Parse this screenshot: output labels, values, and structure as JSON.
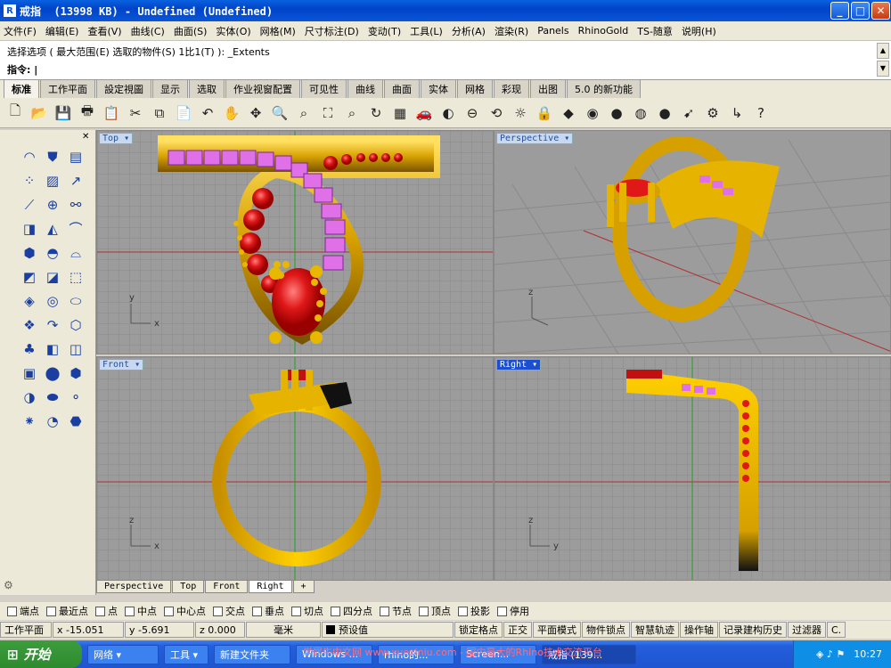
{
  "window": {
    "title": "戒指  (13998 KB) - Undefined (Undefined)",
    "min": "_",
    "max": "□",
    "close": "✕"
  },
  "menu": [
    "文件(F)",
    "编辑(E)",
    "查看(V)",
    "曲线(C)",
    "曲面(S)",
    "实体(O)",
    "网格(M)",
    "尺寸标注(D)",
    "变动(T)",
    "工具(L)",
    "分析(A)",
    "渲染(R)",
    "Panels",
    "RhinoGold",
    "TS-随意",
    "说明(H)"
  ],
  "command": {
    "history": "选择选项 ( 最大范围(E) 选取的物件(S) 1比1(T) ): _Extents",
    "prompt": "指令: |"
  },
  "tabs": [
    "标准",
    "工作平面",
    "設定視圖",
    "显示",
    "选取",
    "作业视窗配置",
    "可见性",
    "曲线",
    "曲面",
    "实体",
    "网格",
    "彩现",
    "出图",
    "5.0 的新功能"
  ],
  "toolbar_icons": [
    "new-icon",
    "open-icon",
    "save-icon",
    "print-icon",
    "import-icon",
    "cut-icon",
    "copy-icon",
    "paste-icon",
    "undo-icon",
    "pan-icon",
    "rotate-view-icon",
    "zoom-icon",
    "zoom-window-icon",
    "zoom-extents-icon",
    "zoom-selected-icon",
    "redo-view-icon",
    "four-viewports-icon",
    "car-icon",
    "hide-icon",
    "show-icon",
    "lock-icon",
    "light-icon",
    "lock2-icon",
    "layer-icon",
    "color-wheel-icon",
    "render-sphere-icon",
    "material-sphere-icon",
    "blue-sphere-icon",
    "options-icon",
    "settings-icon",
    "history-icon",
    "help-icon"
  ],
  "toolbar_glyphs": [
    "🗋",
    "📂",
    "💾",
    "🖶",
    "📋",
    "✂",
    "⧉",
    "📄",
    "↶",
    "✋",
    "✥",
    "🔍",
    "⌕",
    "⛶",
    "⌕",
    "↻",
    "▦",
    "🚗",
    "◐",
    "⊖",
    "⟲",
    "☼",
    "🔒",
    "◆",
    "◉",
    "●",
    "◍",
    "●",
    "➹",
    "⚙",
    "↳",
    "?"
  ],
  "left_tools": [
    "◠",
    "⛊",
    "▤",
    "⁘",
    "▨",
    "↗",
    "⟋",
    "⊕",
    "⚯",
    "◨",
    "◭",
    "⌒",
    "⬢",
    "◓",
    "⌓",
    "◩",
    "◪",
    "⬚",
    "◈",
    "◎",
    "⬭",
    "❖",
    "↷",
    "⬡",
    "♣",
    "◧",
    "◫",
    "▣",
    "⬤",
    "⬢",
    "◑",
    "⬬",
    "⚬",
    "⁕",
    "◔",
    "⬣"
  ],
  "viewports": {
    "top": "Top",
    "perspective": "Perspective",
    "front": "Front",
    "right": "Right"
  },
  "axis": {
    "x": "x",
    "y": "y",
    "z": "z"
  },
  "vp_tabs": [
    "Perspective",
    "Top",
    "Front",
    "Right",
    "+"
  ],
  "osnap": [
    "端点",
    "最近点",
    "点",
    "中点",
    "中心点",
    "交点",
    "垂点",
    "切点",
    "四分点",
    "节点",
    "顶点",
    "投影",
    "停用"
  ],
  "status": {
    "cplane": "工作平面",
    "x": "x -15.051",
    "y": "y -5.691",
    "z": "z 0.000",
    "unit": "毫米",
    "layer": "预设值",
    "items": [
      "锁定格点",
      "正交",
      "平面模式",
      "物件锁点",
      "智慧轨迹",
      "操作轴",
      "记录建构历史",
      "过滤器",
      "C."
    ]
  },
  "taskbar": {
    "start": "开始",
    "buttons": [
      "网络 ▾",
      "工具 ▾",
      "新建文件夹",
      "Windows ...",
      "rhino的...",
      "Screen...",
      "戒指 (139..."
    ],
    "clock": "10:27"
  },
  "watermark": "学犀牛中文网 www.xuexiniu.com - 国内最大的Rhino技术交流平台",
  "colors": {
    "gold": "#e6b400",
    "ruby": "#e01818",
    "pink": "#e070e8",
    "grid_bg": "#9c9c9c",
    "xp_blue": "#0a56d8"
  }
}
